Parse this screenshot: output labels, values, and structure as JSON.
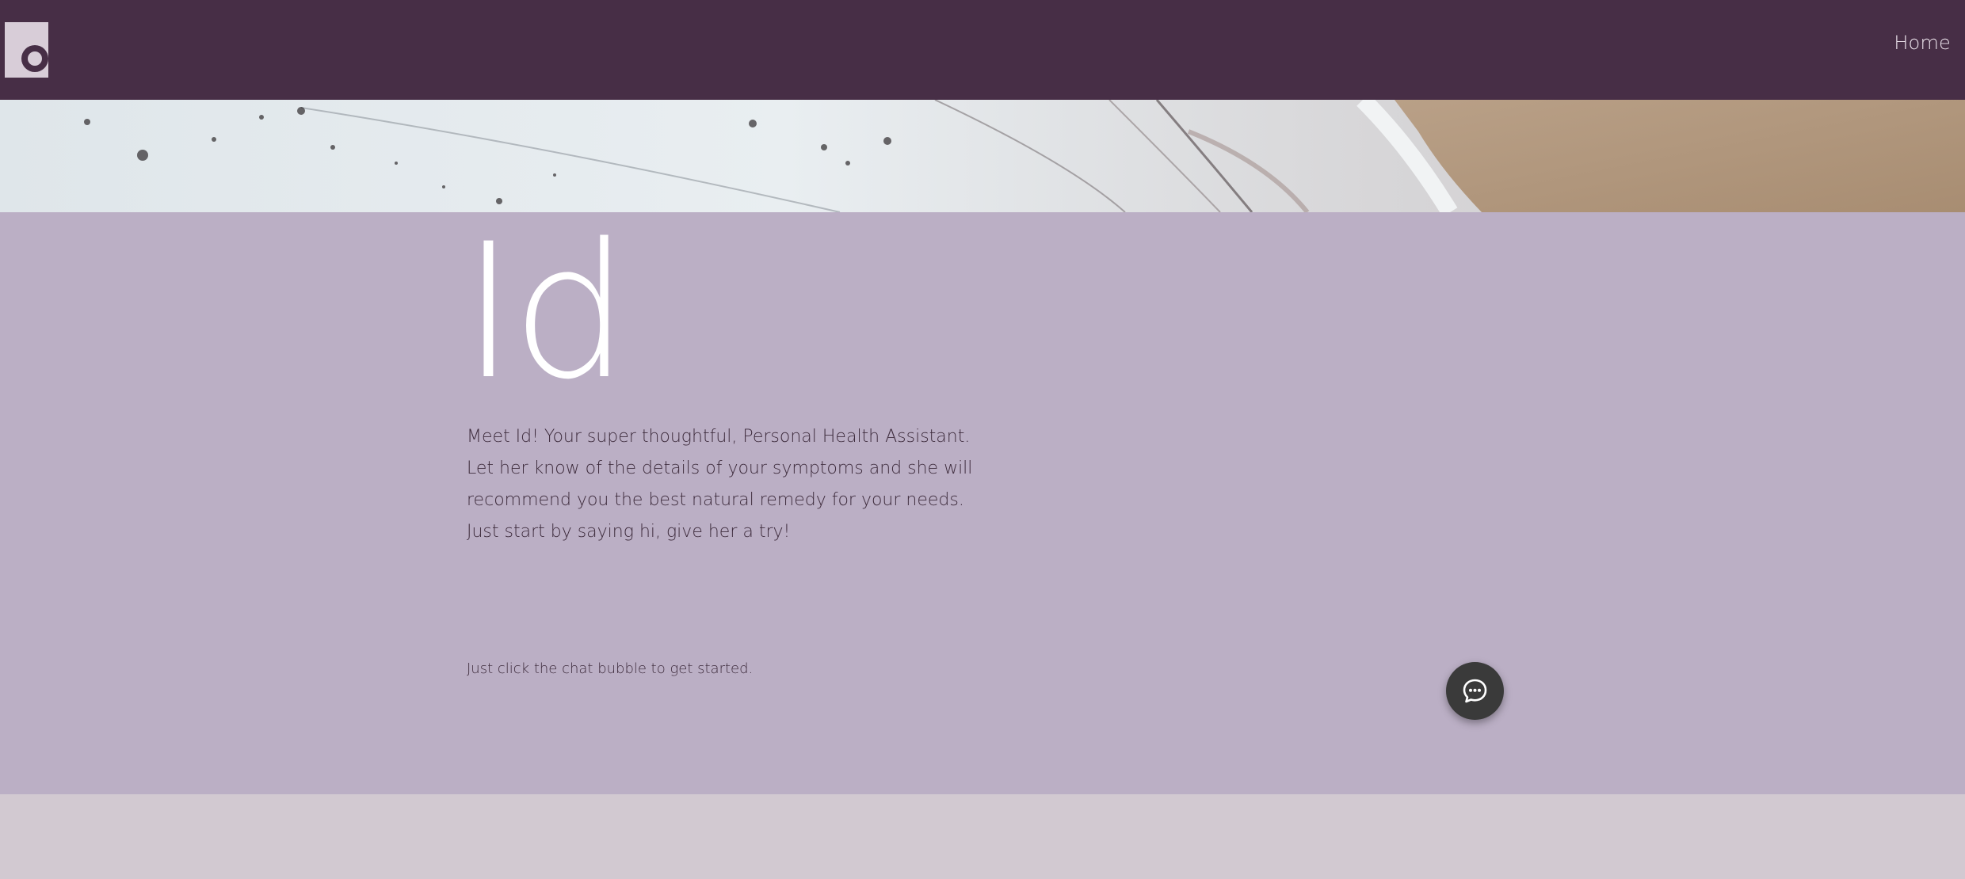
{
  "header": {
    "logo_icon": "site-logo-icon",
    "nav": {
      "home_label": "Home"
    }
  },
  "banner": {
    "image": "snow-and-sand-aerial-photo"
  },
  "hero": {
    "brand_name": "Id",
    "description": "Meet Id! Your super thoughtful, Personal Health Assistant. Let her know of the details of your symptoms and she will recommend you the best natural remedy for your needs. Just start by saying hi, give her a try!",
    "cta_text": "Just click the chat bubble to get started."
  },
  "chat": {
    "icon": "chat-bubble-icon"
  },
  "colors": {
    "header_bg": "#472e46",
    "hero_bg": "#bbafc5",
    "footer_bg": "#d2c9d1",
    "chat_button_bg": "#3a3a3a",
    "text": "#3e2c3d"
  }
}
